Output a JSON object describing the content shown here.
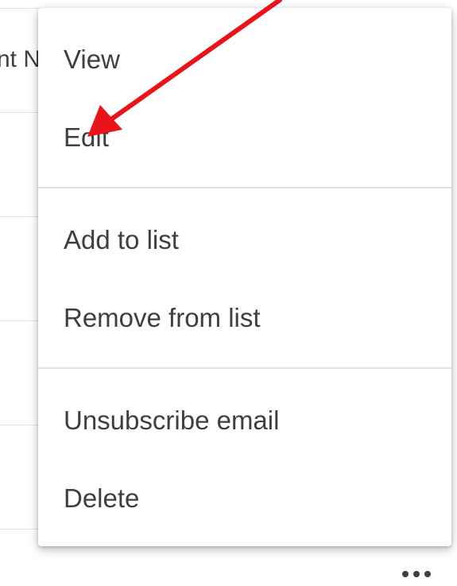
{
  "background": {
    "partial_cell_text": "nt N"
  },
  "menu": {
    "groups": [
      {
        "items": [
          {
            "label": "View"
          },
          {
            "label": "Edit"
          }
        ]
      },
      {
        "items": [
          {
            "label": "Add to list"
          },
          {
            "label": "Remove from list"
          }
        ]
      },
      {
        "items": [
          {
            "label": "Unsubscribe email"
          },
          {
            "label": "Delete"
          }
        ]
      }
    ]
  },
  "more_button": {
    "icon": "more-horizontal-icon"
  },
  "annotation": {
    "color": "#e8141a",
    "target": "menu-item-edit"
  },
  "colors": {
    "text": "#3c4043",
    "divider": "#dfe3e7",
    "arrow": "#e8141a"
  }
}
